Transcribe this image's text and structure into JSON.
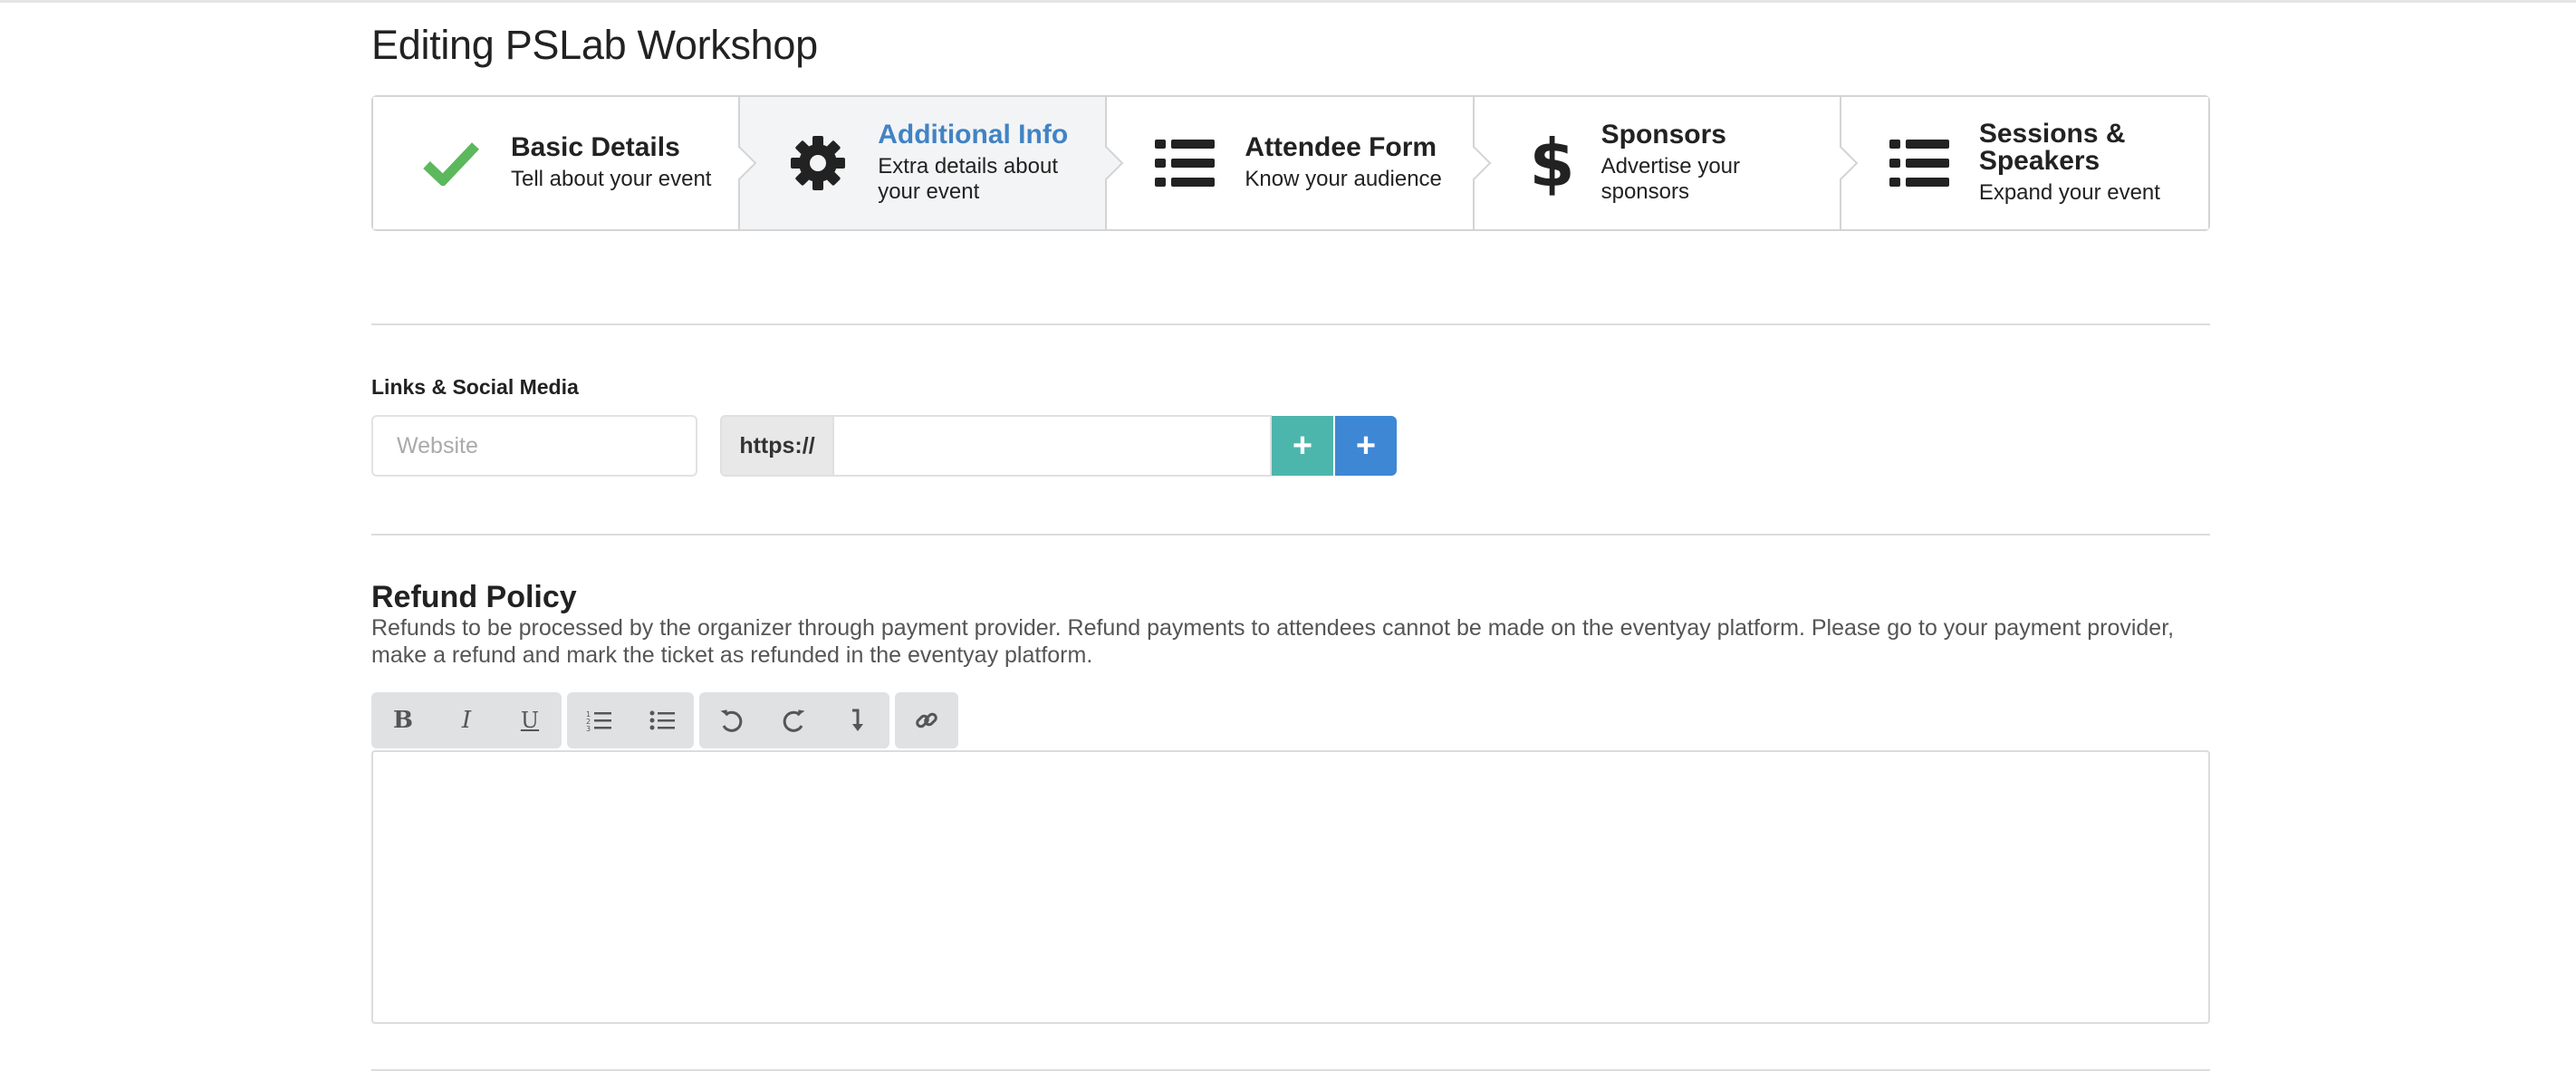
{
  "page": {
    "title": "Editing PSLab Workshop"
  },
  "steps": [
    {
      "title": "Basic Details",
      "desc": "Tell about your event",
      "icon": "check-icon",
      "state": "completed"
    },
    {
      "title": "Additional Info",
      "desc": "Extra details about your event",
      "icon": "gear-icon",
      "state": "active"
    },
    {
      "title": "Attendee Form",
      "desc": "Know your audience",
      "icon": "list-icon",
      "state": "pending"
    },
    {
      "title": "Sponsors",
      "desc": "Advertise your sponsors",
      "icon": "dollar-icon",
      "state": "pending"
    },
    {
      "title": "Sessions & Speakers",
      "desc": "Expand your event",
      "icon": "list-icon",
      "state": "pending"
    }
  ],
  "links": {
    "label": "Links & Social Media",
    "website_placeholder": "Website",
    "website_value": "",
    "url_prefix": "https://",
    "url_value": "",
    "add_button_icon": "plus-icon",
    "add_more_button_icon": "plus-icon"
  },
  "refund": {
    "title": "Refund Policy",
    "description": "Refunds to be processed by the organizer through payment provider. Refund payments to attendees cannot be made on the eventyay platform. Please go to your payment provider, make a refund and mark the ticket as refunded in the eventyay platform.",
    "editor_value": ""
  },
  "toolbar": {
    "groups": [
      [
        "bold-icon",
        "italic-icon",
        "underline-icon"
      ],
      [
        "ordered-list-icon",
        "unordered-list-icon"
      ],
      [
        "undo-icon",
        "redo-icon",
        "line-break-icon"
      ],
      [
        "link-icon"
      ]
    ]
  },
  "colors": {
    "accent": "#4183c4",
    "check": "#5cb85c",
    "teal_button": "#4db6ac",
    "blue_button": "#3d87d5"
  }
}
